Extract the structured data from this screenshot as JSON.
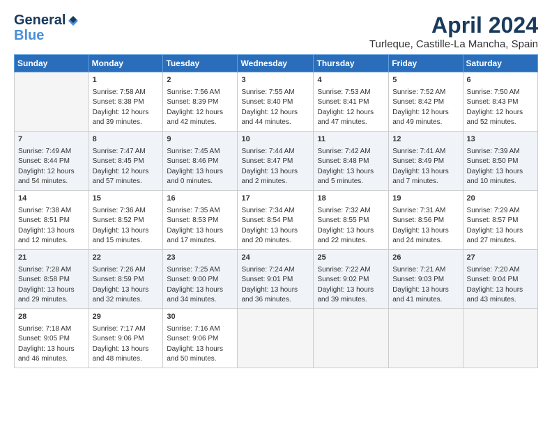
{
  "header": {
    "logo_line1": "General",
    "logo_line2": "Blue",
    "title": "April 2024",
    "subtitle": "Turleque, Castille-La Mancha, Spain"
  },
  "columns": [
    "Sunday",
    "Monday",
    "Tuesday",
    "Wednesday",
    "Thursday",
    "Friday",
    "Saturday"
  ],
  "weeks": [
    [
      {
        "day": "",
        "text": ""
      },
      {
        "day": "1",
        "text": "Sunrise: 7:58 AM\nSunset: 8:38 PM\nDaylight: 12 hours\nand 39 minutes."
      },
      {
        "day": "2",
        "text": "Sunrise: 7:56 AM\nSunset: 8:39 PM\nDaylight: 12 hours\nand 42 minutes."
      },
      {
        "day": "3",
        "text": "Sunrise: 7:55 AM\nSunset: 8:40 PM\nDaylight: 12 hours\nand 44 minutes."
      },
      {
        "day": "4",
        "text": "Sunrise: 7:53 AM\nSunset: 8:41 PM\nDaylight: 12 hours\nand 47 minutes."
      },
      {
        "day": "5",
        "text": "Sunrise: 7:52 AM\nSunset: 8:42 PM\nDaylight: 12 hours\nand 49 minutes."
      },
      {
        "day": "6",
        "text": "Sunrise: 7:50 AM\nSunset: 8:43 PM\nDaylight: 12 hours\nand 52 minutes."
      }
    ],
    [
      {
        "day": "7",
        "text": "Sunrise: 7:49 AM\nSunset: 8:44 PM\nDaylight: 12 hours\nand 54 minutes."
      },
      {
        "day": "8",
        "text": "Sunrise: 7:47 AM\nSunset: 8:45 PM\nDaylight: 12 hours\nand 57 minutes."
      },
      {
        "day": "9",
        "text": "Sunrise: 7:45 AM\nSunset: 8:46 PM\nDaylight: 13 hours\nand 0 minutes."
      },
      {
        "day": "10",
        "text": "Sunrise: 7:44 AM\nSunset: 8:47 PM\nDaylight: 13 hours\nand 2 minutes."
      },
      {
        "day": "11",
        "text": "Sunrise: 7:42 AM\nSunset: 8:48 PM\nDaylight: 13 hours\nand 5 minutes."
      },
      {
        "day": "12",
        "text": "Sunrise: 7:41 AM\nSunset: 8:49 PM\nDaylight: 13 hours\nand 7 minutes."
      },
      {
        "day": "13",
        "text": "Sunrise: 7:39 AM\nSunset: 8:50 PM\nDaylight: 13 hours\nand 10 minutes."
      }
    ],
    [
      {
        "day": "14",
        "text": "Sunrise: 7:38 AM\nSunset: 8:51 PM\nDaylight: 13 hours\nand 12 minutes."
      },
      {
        "day": "15",
        "text": "Sunrise: 7:36 AM\nSunset: 8:52 PM\nDaylight: 13 hours\nand 15 minutes."
      },
      {
        "day": "16",
        "text": "Sunrise: 7:35 AM\nSunset: 8:53 PM\nDaylight: 13 hours\nand 17 minutes."
      },
      {
        "day": "17",
        "text": "Sunrise: 7:34 AM\nSunset: 8:54 PM\nDaylight: 13 hours\nand 20 minutes."
      },
      {
        "day": "18",
        "text": "Sunrise: 7:32 AM\nSunset: 8:55 PM\nDaylight: 13 hours\nand 22 minutes."
      },
      {
        "day": "19",
        "text": "Sunrise: 7:31 AM\nSunset: 8:56 PM\nDaylight: 13 hours\nand 24 minutes."
      },
      {
        "day": "20",
        "text": "Sunrise: 7:29 AM\nSunset: 8:57 PM\nDaylight: 13 hours\nand 27 minutes."
      }
    ],
    [
      {
        "day": "21",
        "text": "Sunrise: 7:28 AM\nSunset: 8:58 PM\nDaylight: 13 hours\nand 29 minutes."
      },
      {
        "day": "22",
        "text": "Sunrise: 7:26 AM\nSunset: 8:59 PM\nDaylight: 13 hours\nand 32 minutes."
      },
      {
        "day": "23",
        "text": "Sunrise: 7:25 AM\nSunset: 9:00 PM\nDaylight: 13 hours\nand 34 minutes."
      },
      {
        "day": "24",
        "text": "Sunrise: 7:24 AM\nSunset: 9:01 PM\nDaylight: 13 hours\nand 36 minutes."
      },
      {
        "day": "25",
        "text": "Sunrise: 7:22 AM\nSunset: 9:02 PM\nDaylight: 13 hours\nand 39 minutes."
      },
      {
        "day": "26",
        "text": "Sunrise: 7:21 AM\nSunset: 9:03 PM\nDaylight: 13 hours\nand 41 minutes."
      },
      {
        "day": "27",
        "text": "Sunrise: 7:20 AM\nSunset: 9:04 PM\nDaylight: 13 hours\nand 43 minutes."
      }
    ],
    [
      {
        "day": "28",
        "text": "Sunrise: 7:18 AM\nSunset: 9:05 PM\nDaylight: 13 hours\nand 46 minutes."
      },
      {
        "day": "29",
        "text": "Sunrise: 7:17 AM\nSunset: 9:06 PM\nDaylight: 13 hours\nand 48 minutes."
      },
      {
        "day": "30",
        "text": "Sunrise: 7:16 AM\nSunset: 9:06 PM\nDaylight: 13 hours\nand 50 minutes."
      },
      {
        "day": "",
        "text": ""
      },
      {
        "day": "",
        "text": ""
      },
      {
        "day": "",
        "text": ""
      },
      {
        "day": "",
        "text": ""
      }
    ]
  ]
}
